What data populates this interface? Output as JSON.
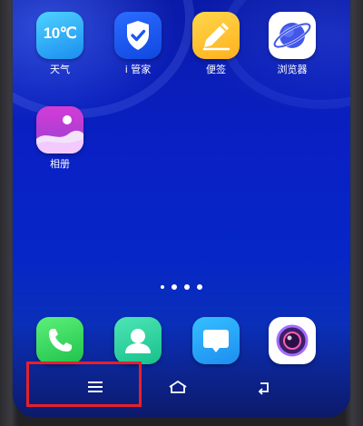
{
  "home_screen": {
    "apps_row1": [
      {
        "label": "天气",
        "icon": "weather-icon",
        "badge_text": "10℃"
      },
      {
        "label": "i 管家",
        "icon": "shield-check-icon"
      },
      {
        "label": "便签",
        "icon": "pencil-icon"
      },
      {
        "label": "浏览器",
        "icon": "planet-icon"
      }
    ],
    "apps_row2": [
      {
        "label": "相册",
        "icon": "photo-album-icon"
      }
    ],
    "page_indicator": {
      "pages": 4,
      "current": 1
    },
    "dock": [
      {
        "icon": "phone-icon"
      },
      {
        "icon": "contacts-icon"
      },
      {
        "icon": "messages-icon"
      },
      {
        "icon": "camera-icon"
      }
    ]
  },
  "navbar": {
    "buttons": [
      {
        "icon": "menu-icon"
      },
      {
        "icon": "home-icon"
      },
      {
        "icon": "back-icon"
      }
    ]
  },
  "annotation": {
    "highlight_color": "#e8202a",
    "target": "menu-button"
  },
  "colors": {
    "wallpaper": "#0a20c4",
    "weather": "#1a8ef0",
    "notes": "#ffb11f",
    "album": "#b13ed4"
  }
}
